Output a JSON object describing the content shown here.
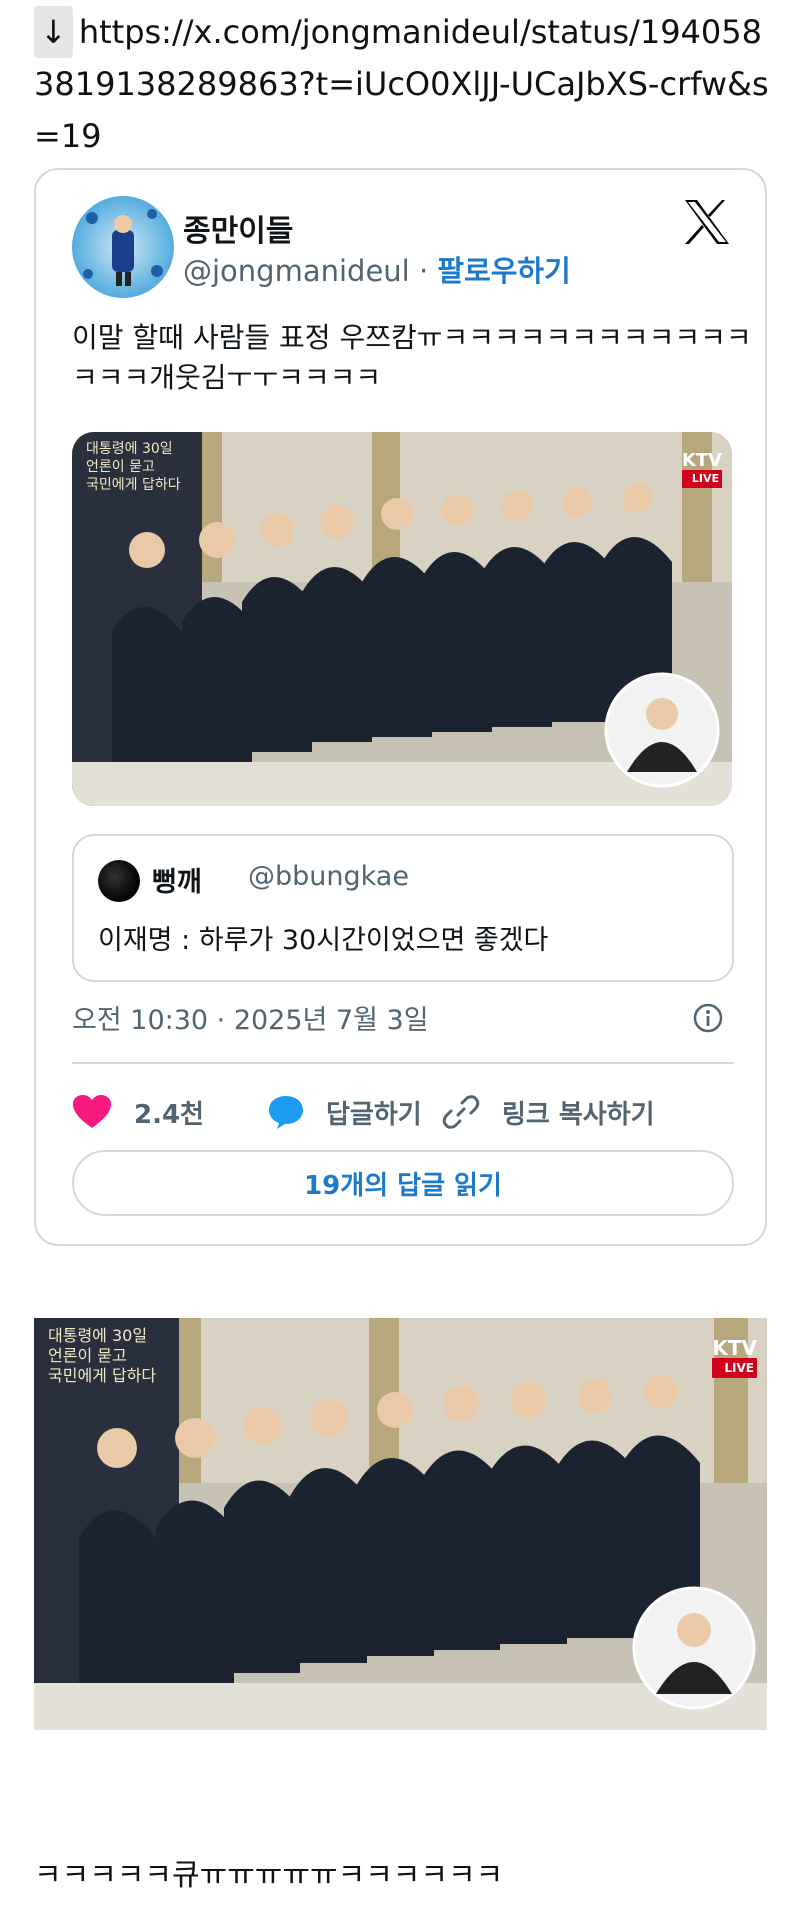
{
  "link": {
    "arrow": "↓",
    "url": "https://x.com/jongmanideul/status/1940583819138289863?t=iUcO0XlJJ-UCaJbXS-crfw&s=19"
  },
  "tweet": {
    "display_name": "종만이들",
    "handle": "@jongmanideul",
    "separator": "·",
    "follow_label": "팔로우하기",
    "text": "이말 할때 사람들 표정 우쯔캄ㅠㅋㅋㅋㅋㅋㅋㅋㅋㅋㅋㅋㅋㅋㅋㅋ개웃김ㅜㅜㅋㅋㅋㅋ",
    "media_badge": {
      "top": "KTV",
      "bottom": "LIVE"
    },
    "media_caption": [
      "대통령에 30일",
      "언론이 묻고",
      "국민에게 답하다"
    ],
    "timestamp": "오전 10:30 · 2025년 7월 3일",
    "actions": {
      "like_count": "2.4천",
      "reply_label": "답글하기",
      "copy_link_label": "링크 복사하기"
    },
    "read_replies_label": "19개의 답글 읽기",
    "quote": {
      "display_name": "뻥깨",
      "handle": "@bbungkae",
      "text": "이재명 : 하루가 30시간이었으면 좋겠다"
    }
  },
  "footer_text": "ㅋㅋㅋㅋㅋ큐ㅠㅠㅠㅠㅠㅋㅋㅋㅋㅋㅋ",
  "colors": {
    "accent": "#1d79c9",
    "like": "#f91880",
    "reply": "#1d9bf0",
    "muted": "#536471",
    "border": "#cfd9de"
  },
  "icons": [
    "x-logo-icon",
    "info-icon",
    "heart-icon",
    "speech-bubble-icon",
    "link-icon"
  ]
}
